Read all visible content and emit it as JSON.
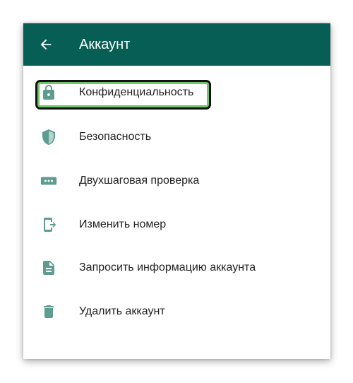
{
  "app_bar": {
    "title": "Аккаунт"
  },
  "colors": {
    "app_bar": "#075e54",
    "icon": "#5e9c90",
    "highlight_outer": "#111111",
    "highlight_inner": "#6fc56a"
  },
  "menu": {
    "items": [
      {
        "label": "Конфиденциальность",
        "icon": "lock-icon",
        "highlighted": true
      },
      {
        "label": "Безопасность",
        "icon": "shield-icon"
      },
      {
        "label": "Двухшаговая проверка",
        "icon": "dots-password-icon"
      },
      {
        "label": "Изменить номер",
        "icon": "phone-change-icon"
      },
      {
        "label": "Запросить информацию аккаунта",
        "icon": "document-icon"
      },
      {
        "label": "Удалить аккаунт",
        "icon": "trash-icon"
      }
    ]
  }
}
